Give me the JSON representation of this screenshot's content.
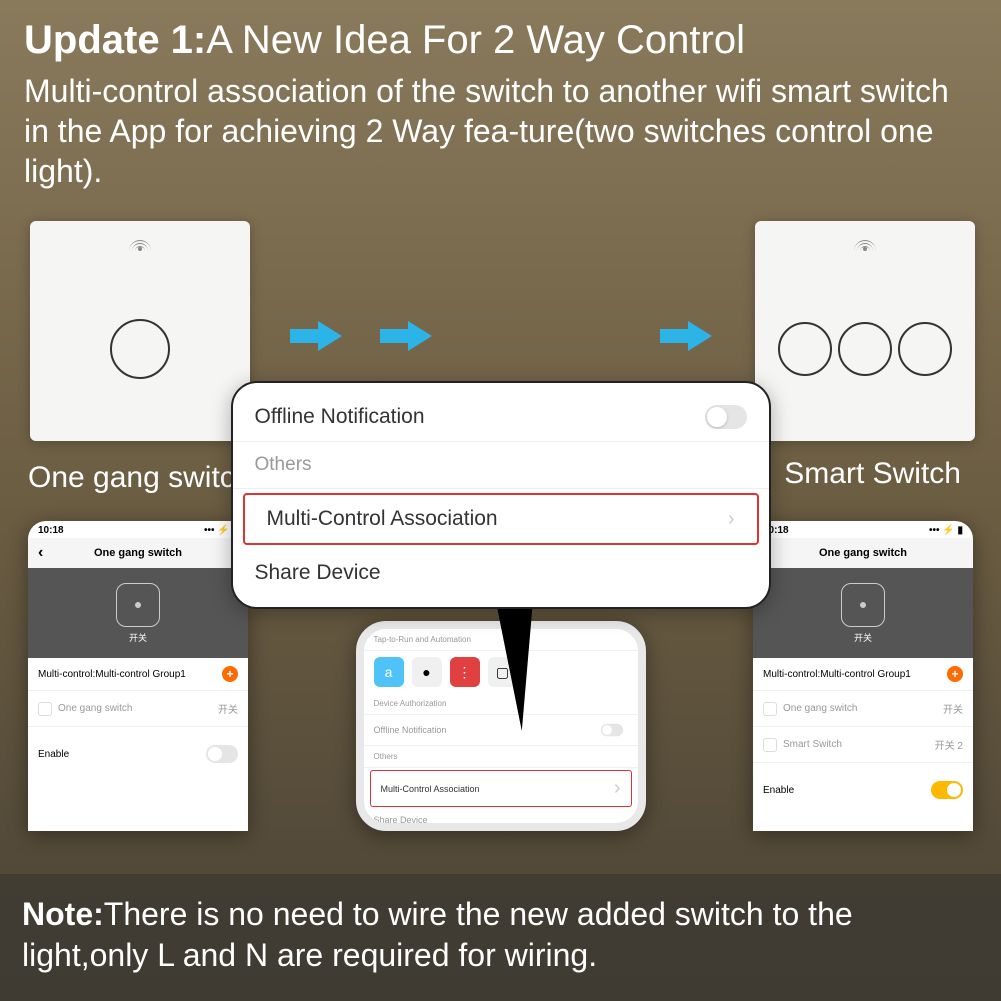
{
  "header": {
    "title_bold": "Update 1:",
    "title_rest": "A New Idea For 2 Way Control",
    "subtitle": "Multi-control association of the switch to another wifi smart switch in the App for achieving 2 Way fea-ture(two switches control one light)."
  },
  "labels": {
    "one_gang_switch": "One gang switch",
    "smart_switch": "Smart Switch"
  },
  "popup": {
    "offline_notification": "Offline Notification",
    "others": "Others",
    "multi_control": "Multi-Control Association",
    "share_device": "Share Device"
  },
  "phone_left": {
    "time": "10:18",
    "nav_title": "One gang switch",
    "device_label": "开关",
    "group_label": "Multi-control:Multi-control Group1",
    "item1": "One gang switch",
    "item1_right": "开关",
    "enable": "Enable"
  },
  "phone_right": {
    "time": "10:18",
    "nav_title": "One gang switch",
    "device_label": "开关",
    "group_label": "Multi-control:Multi-control Group1",
    "item1": "One gang switch",
    "item1_right": "开关",
    "item2": "Smart Switch",
    "item2_right": "开关 2",
    "enable": "Enable"
  },
  "phone_center": {
    "tap_to_run": "Tap-to-Run and Automation",
    "apps": [
      "alexa",
      "google",
      "etc",
      "tmall"
    ],
    "device_auth": "Device Authorization",
    "offline": "Offline Notification",
    "others": "Others",
    "multi_control": "Multi-Control Association",
    "share": "Share Device"
  },
  "footer": {
    "note_bold": "Note:",
    "note_rest": "There is no need to wire the new added switch to the light,only L and N are required for wiring."
  }
}
